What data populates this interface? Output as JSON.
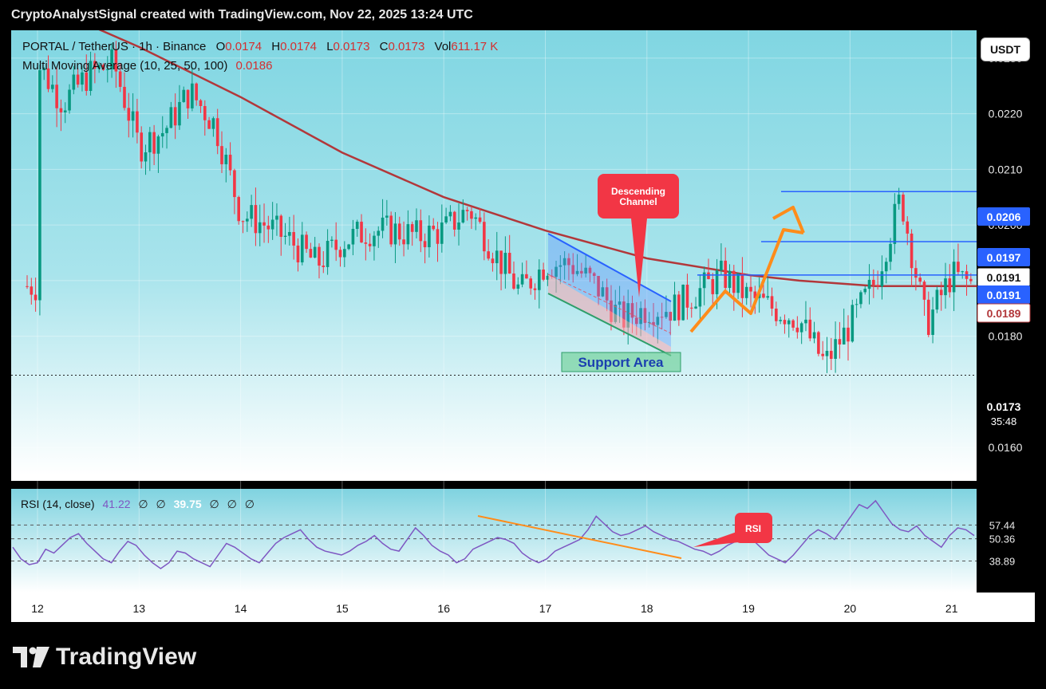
{
  "header": {
    "title": "CryptoAnalystSignal created with TradingView.com, Nov 22, 2025 13:24 UTC"
  },
  "legend": {
    "symbol": "PORTAL / TetherUS · 1h · Binance",
    "o_label": "O",
    "o_value": "0.0174",
    "h_label": "H",
    "h_value": "0.0174",
    "l_label": "L",
    "l_value": "0.0173",
    "c_label": "C",
    "c_value": "0.0173",
    "vol_label": "Vol",
    "vol_value": "611.17 K",
    "ma_label": "Multi Moving Average (10, 25, 50, 100)",
    "ma_value": "0.0186"
  },
  "rsi_legend": {
    "label": "RSI (14, close)",
    "value1": "41.22",
    "value2": "39.75",
    "empty": "∅"
  },
  "currency_button": "USDT",
  "brand": "TradingView",
  "colors": {
    "up": "#089981",
    "down": "#f23645",
    "ma": "#b2373a",
    "channel": "#2962ff",
    "orange": "#ff8c1a",
    "bg_top": "#80d6e2",
    "bg_bottom": "#ffffff"
  },
  "chart_data": {
    "type": "candlestick",
    "symbol": "PORTAL / TetherUS",
    "interval": "1h",
    "exchange": "Binance",
    "x_ticks": [
      "12",
      "13",
      "14",
      "15",
      "16",
      "17",
      "18",
      "19",
      "20",
      "21"
    ],
    "y_ticks": [
      "0.0160",
      "0.0180",
      "0.0190",
      "0.0200",
      "0.0210",
      "0.0220",
      "0.0230"
    ],
    "ylim": [
      0.0155,
      0.0235
    ],
    "last_ohlc": {
      "open": 0.0174,
      "high": 0.0174,
      "low": 0.0173,
      "close": 0.0173,
      "volume": "611.17 K"
    },
    "price_path": [
      [
        "12 00:00",
        0.0229
      ],
      [
        "12 06:00",
        0.0222
      ],
      [
        "12 12:00",
        0.0227
      ],
      [
        "12 18:00",
        0.0229
      ],
      [
        "13 00:00",
        0.0214
      ],
      [
        "13 06:00",
        0.0217
      ],
      [
        "13 12:00",
        0.0224
      ],
      [
        "13 18:00",
        0.0218
      ],
      [
        "14 00:00",
        0.0202
      ],
      [
        "14 06:00",
        0.02
      ],
      [
        "14 12:00",
        0.0197
      ],
      [
        "14 18:00",
        0.0193
      ],
      [
        "15 00:00",
        0.0197
      ],
      [
        "15 06:00",
        0.0199
      ],
      [
        "15 12:00",
        0.0199
      ],
      [
        "15 18:00",
        0.0198
      ],
      [
        "16 00:00",
        0.0199
      ],
      [
        "16 06:00",
        0.0203
      ],
      [
        "16 12:00",
        0.0195
      ],
      [
        "16 18:00",
        0.0188
      ],
      [
        "17 00:00",
        0.0193
      ],
      [
        "17 06:00",
        0.0193
      ],
      [
        "17 12:00",
        0.0189
      ],
      [
        "17 18:00",
        0.0183
      ],
      [
        "18 00:00",
        0.0185
      ],
      [
        "18 06:00",
        0.0185
      ],
      [
        "18 12:00",
        0.0188
      ],
      [
        "18 18:00",
        0.0191
      ],
      [
        "19 00:00",
        0.0187
      ],
      [
        "19 06:00",
        0.0185
      ],
      [
        "19 12:00",
        0.0183
      ],
      [
        "19 18:00",
        0.0175
      ],
      [
        "20 00:00",
        0.0182
      ],
      [
        "20 06:00",
        0.019
      ],
      [
        "20 12:00",
        0.0205
      ],
      [
        "20 18:00",
        0.0182
      ],
      [
        "21 00:00",
        0.0191
      ],
      [
        "21 06:00",
        0.0189
      ]
    ],
    "ma_path": [
      [
        "12 12:00",
        0.0236
      ],
      [
        "13 00:00",
        0.0232
      ],
      [
        "14 00:00",
        0.0223
      ],
      [
        "15 00:00",
        0.0213
      ],
      [
        "16 00:00",
        0.0205
      ],
      [
        "17 00:00",
        0.0199
      ],
      [
        "18 00:00",
        0.0194
      ],
      [
        "19 00:00",
        0.0191
      ],
      [
        "19 12:00",
        0.019
      ],
      [
        "20 06:00",
        0.0189
      ],
      [
        "21 06:00",
        0.0189
      ]
    ],
    "price_labels": [
      {
        "value": "0.0206",
        "kind": "level"
      },
      {
        "value": "0.0197",
        "kind": "level"
      },
      {
        "value": "0.0191",
        "kind": "current"
      },
      {
        "value": "0.0191",
        "kind": "level"
      },
      {
        "value": "0.0189",
        "kind": "ma"
      },
      {
        "value": "0.0173",
        "countdown": "35:48",
        "kind": "last"
      }
    ],
    "horizontal_levels": [
      0.0206,
      0.0197,
      0.0191
    ],
    "annotations": {
      "descending_channel": "Descending\nChannel",
      "support_area": "Support Area",
      "rsi_tag": "RSI"
    },
    "rsi": {
      "period": 14,
      "source": "close",
      "ylim": [
        28,
        72
      ],
      "levels": [
        "57.44",
        "50.36",
        "38.89"
      ],
      "level_values": [
        57.44,
        50.36,
        38.89
      ],
      "values": [
        46,
        40,
        37,
        38,
        45,
        43,
        47,
        51,
        53,
        48,
        44,
        40,
        38,
        44,
        49,
        47,
        42,
        38,
        35,
        38,
        44,
        43,
        40,
        38,
        36,
        42,
        48,
        46,
        43,
        40,
        38,
        43,
        48,
        51,
        53,
        55,
        50,
        46,
        44,
        43,
        42,
        44,
        47,
        49,
        52,
        48,
        45,
        44,
        50,
        56,
        52,
        47,
        44,
        42,
        38,
        40,
        45,
        47,
        49,
        51,
        50,
        48,
        43,
        40,
        38,
        40,
        44,
        46,
        48,
        50,
        55,
        62,
        58,
        54,
        52,
        53,
        55,
        57,
        54,
        52,
        50,
        49,
        47,
        45,
        44,
        42,
        44,
        47,
        49,
        52,
        50,
        46,
        42,
        40,
        38,
        42,
        47,
        52,
        55,
        53,
        50,
        56,
        62,
        68,
        66,
        70,
        64,
        58,
        55,
        54,
        57,
        52,
        49,
        46,
        52,
        56,
        55,
        52
      ]
    }
  }
}
